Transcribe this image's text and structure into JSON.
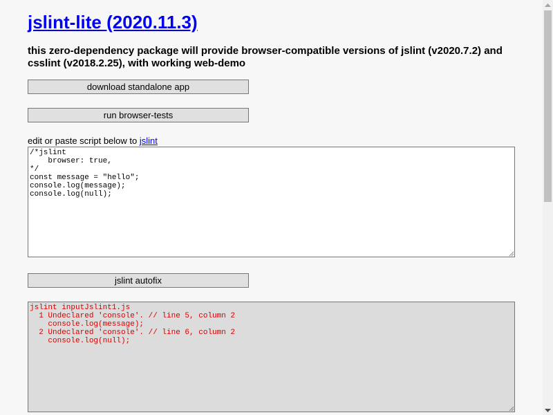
{
  "header": {
    "title": "jslint-lite (2020.11.3)",
    "subtitle": "this zero-dependency package will provide browser-compatible versions of jslint (v2020.7.2) and csslint (v2018.2.25), with working web-demo"
  },
  "buttons": {
    "download": "download standalone app",
    "browser_tests": "run browser-tests",
    "autofix": "jslint autofix"
  },
  "editor": {
    "label_prefix": "edit or paste script below to ",
    "label_link": "jslint",
    "content": "/*jslint\n    browser: true,\n*/\nconst message = \"hello\";\nconsole.log(message);\nconsole.log(null);"
  },
  "output": {
    "content": "jslint inputJslint1.js\n  1 Undeclared 'console'. // line 5, column 2\n    console.log(message);\n  2 Undeclared 'console'. // line 6, column 2\n    console.log(null);"
  },
  "colors": {
    "link": "#0000ee",
    "error_text": "#d40000",
    "output_bg": "#dcdcdc",
    "button_bg": "#e0e0e0"
  },
  "icons": {
    "scroll_up": "triangle-up-icon",
    "scroll_down": "triangle-down-icon",
    "resize_grip": "resize-grip-icon"
  }
}
